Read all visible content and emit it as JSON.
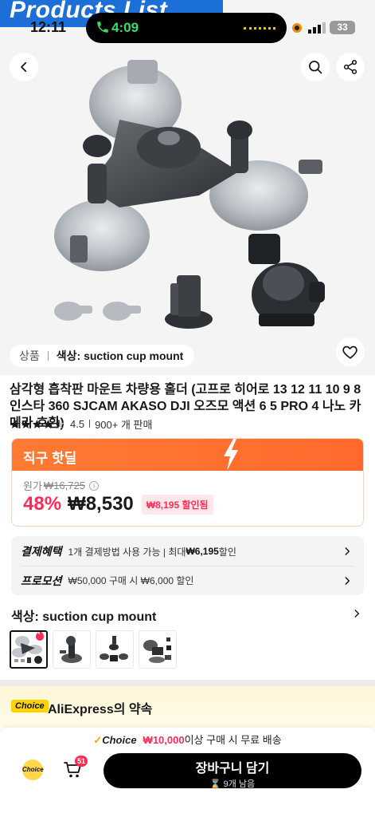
{
  "banner": {
    "text": "Products List"
  },
  "status_bar": {
    "time": "12:11",
    "call_time": "4:09",
    "battery": "33"
  },
  "gallery": {
    "variant_label": "상품",
    "variant_value": "색상: suction cup mount"
  },
  "product": {
    "title": "삼각형 흡착판 마운트 차량용 홀더 (고프로 히어로 13 12 11 10 9 8 인스타 360 SJCAM AKASO DJI 오즈모 액션 6 5 PRO 4 나노 카메라 호환)",
    "rating": "4.5",
    "rating_value": 4.5,
    "sold": "900+ 개 판매"
  },
  "deal": {
    "header": "직구 핫딜",
    "original_label": "원가",
    "original_price": "₩16,725",
    "discount_pct": "48%",
    "price": "₩8,530",
    "discount_badge": "₩8,195 할인됨"
  },
  "benefits": [
    {
      "tag": "결제혜택",
      "text_pre": "1개 결제방법 사용 가능 | 최대 ",
      "text_bold": "₩6,195",
      "text_post": " 할인"
    },
    {
      "tag": "프로모션",
      "text_pre": "₩50,000 구매 시 ₩6,000 할인",
      "text_bold": "",
      "text_post": ""
    }
  ],
  "color_section": {
    "label": "색상: suction cup mount"
  },
  "promise": {
    "badge": "Choice",
    "text": "AliExpress의 약속"
  },
  "bottom_bar": {
    "ship_choice": "Choice",
    "ship_amount": "₩10,000",
    "ship_text": "이상 구매 시 무료 배송",
    "choice_icon": "Choice",
    "cart_count": "51",
    "cart_button": "장바구니 담기",
    "cart_sub": "⌛ 9개 남음"
  },
  "colors": {
    "accent": "#fe2c55",
    "deal_orange": "#ff7a33",
    "banner_blue": "#1d6fd8"
  }
}
